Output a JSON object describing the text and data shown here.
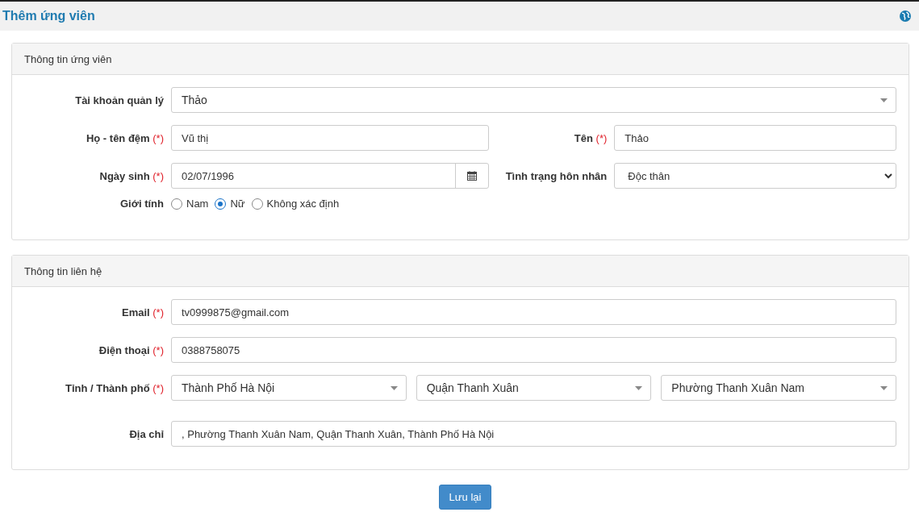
{
  "page": {
    "title": "Thêm ứng viên"
  },
  "sections": [
    {
      "title": "Thông tin ứng viên",
      "rows": [
        {
          "kind": "combo",
          "label": "Tài khoản quản lý",
          "value": "Thảo"
        },
        {
          "kind": "pair",
          "cells": [
            {
              "label": "Họ - tên đệm",
              "required_mark": "(*)",
              "kind": "text",
              "value": "Vũ thị"
            },
            {
              "label": "Tên",
              "required_mark": "(*)",
              "kind": "text",
              "value": "Thảo"
            }
          ]
        },
        {
          "kind": "pair",
          "cells": [
            {
              "label": "Ngày sinh",
              "required_mark": "(*)",
              "kind": "date",
              "value": "02/07/1996"
            },
            {
              "label": "Tình trạng hôn nhân",
              "kind": "select",
              "value": "Độc thân"
            }
          ]
        },
        {
          "kind": "radio",
          "label": "Giới tính",
          "options": [
            {
              "label": "Nam",
              "selected": false
            },
            {
              "label": "Nữ",
              "selected": true
            },
            {
              "label": "Không xác định",
              "selected": false
            }
          ]
        }
      ]
    },
    {
      "title": "Thông tin liên hệ",
      "rows": [
        {
          "kind": "text",
          "label": "Email",
          "required_mark": "(*)",
          "value": "tv0999875@gmail.com"
        },
        {
          "kind": "text",
          "label": "Điện thoại",
          "required_mark": "(*)",
          "value": "0388758075"
        },
        {
          "kind": "combos",
          "label": "Tỉnh / Thành phố",
          "required_mark": "(*)",
          "values": [
            "Thành Phố Hà Nội",
            "Quận Thanh Xuân",
            "Phường Thanh Xuân Nam"
          ]
        },
        {
          "kind": "text",
          "label": "Địa chỉ",
          "value": ", Phường Thanh Xuân Nam, Quận Thanh Xuân, Thành Phố Hà Nội"
        }
      ]
    }
  ],
  "save_button": "Lưu lại"
}
